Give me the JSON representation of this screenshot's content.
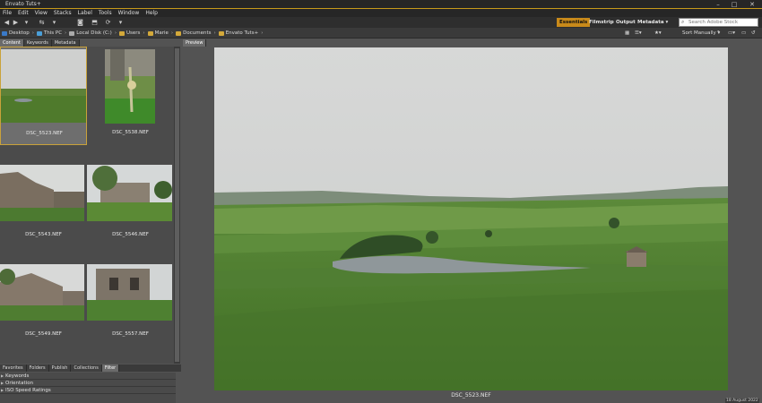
{
  "window": {
    "title": "Envato Tuts+",
    "minimize": "–",
    "maximize": "□",
    "close": "✕"
  },
  "menu": [
    "File",
    "Edit",
    "View",
    "Stacks",
    "Label",
    "Tools",
    "Window",
    "Help"
  ],
  "workspaces": {
    "essentials": "Essentials",
    "filmstrip": "Filmstrip",
    "output": "Output",
    "metadata": "Metadata ▾"
  },
  "search": {
    "placeholder": "Search Adobe Stock"
  },
  "path": [
    "Desktop",
    "This PC",
    "Local Disk (C:)",
    "Users",
    "Marie",
    "Documents",
    "Envato Tuts+"
  ],
  "sort": {
    "label": "Sort Manually ▾"
  },
  "left_tabs": {
    "content": "Content",
    "keywords": "Keywords",
    "metadata": "Metadata"
  },
  "thumbnails": [
    {
      "name": "DSC_5523.NEF",
      "selected": true
    },
    {
      "name": "DSC_5538.NEF"
    },
    {
      "name": "DSC_5543.NEF"
    },
    {
      "name": "DSC_5546.NEF"
    },
    {
      "name": "DSC_5549.NEF"
    },
    {
      "name": "DSC_5557.NEF"
    }
  ],
  "bottom_tabs": {
    "favorites": "Favorites",
    "folders": "Folders",
    "publish": "Publish",
    "collections": "Collections",
    "filter": "Filter"
  },
  "filters": [
    "Keywords",
    "Orientation",
    "ISO Speed Ratings"
  ],
  "preview": {
    "tab": "Preview",
    "caption": "DSC_5523.NEF",
    "date": "18 August 2022"
  },
  "colors": {
    "accent": "#c98a1a",
    "selection_border": "#c9a23a",
    "panel_bg": "#535353"
  }
}
